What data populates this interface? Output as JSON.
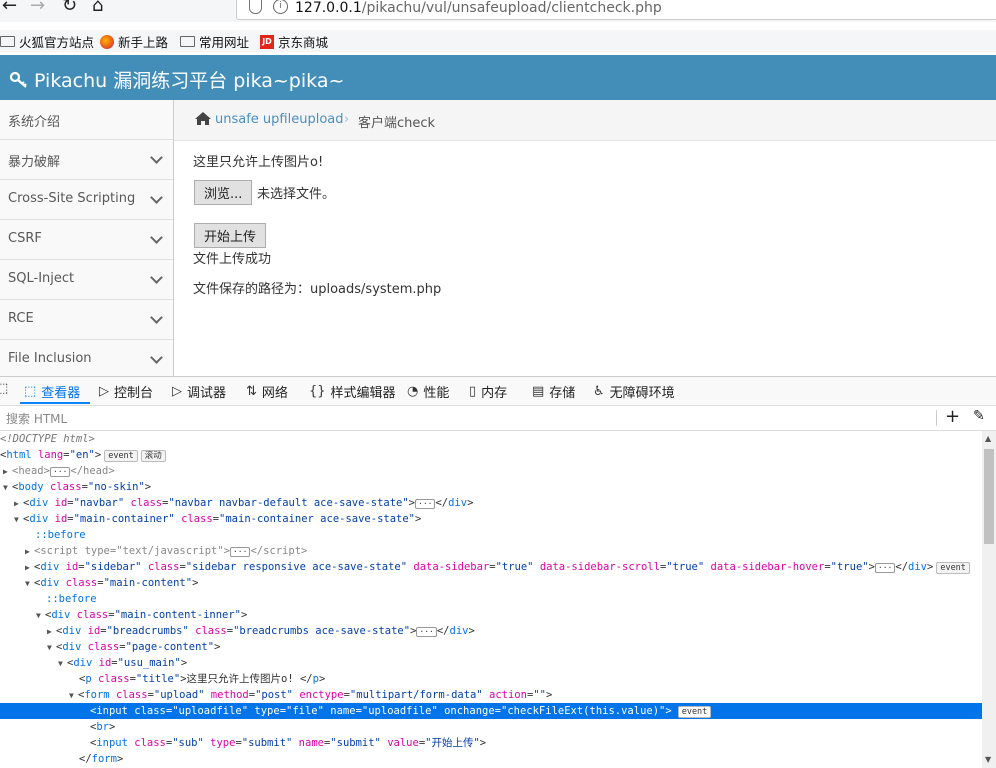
{
  "browser": {
    "url_host": "127.0.0.1",
    "url_path": "/pikachu/vul/unsafeupload/clientcheck.php",
    "bookmarks": [
      "火狐官方站点",
      "新手上路",
      "常用网址",
      "京东商城"
    ]
  },
  "app": {
    "brand": "Pikachu 漏洞练习平台 pika~pika~",
    "sidebar": [
      "系统介绍",
      "暴力破解",
      "Cross-Site Scripting",
      "CSRF",
      "SQL-Inject",
      "RCE",
      "File Inclusion"
    ],
    "breadcrumb": {
      "link": "unsafe upfileupload",
      "sep": "›",
      "current": "客户端check"
    },
    "content": {
      "title": "这里只允许上传图片o!",
      "browse_label": "浏览...",
      "no_file": "未选择文件。",
      "submit_label": "开始上传",
      "success": "文件上传成功",
      "save_path": "文件保存的路径为：uploads/system.php"
    }
  },
  "devtools": {
    "tabs": [
      "查看器",
      "控制台",
      "调试器",
      "网络",
      "样式编辑器",
      "性能",
      "内存",
      "存储",
      "无障碍环境"
    ],
    "active_tab": "查看器",
    "search_placeholder": "搜索 HTML",
    "badges": {
      "event": "event",
      "scroll": "滚动"
    },
    "tree": {
      "doctype": "<!DOCTYPE html>",
      "l1": "html",
      "l1_attr": "lang",
      "l1_val": "\"en\"",
      "l2": "head",
      "l3": "body",
      "l3_attr": "class",
      "l3_val": "\"no-skin\"",
      "l4_id": "\"navbar\"",
      "l4_cls": "\"navbar navbar-default ace-save-state\"",
      "l5_id": "\"main-container\"",
      "l5_cls": "\"main-container ace-save-state\"",
      "before": "::before",
      "l7_type": "\"text/javascript\"",
      "l8_id": "\"sidebar\"",
      "l8_cls": "\"sidebar responsive ace-save-state\"",
      "l8_ds": "\"true\"",
      "l8_dss": "\"true\"",
      "l8_dsh": "\"true\"",
      "l9_cls": "\"main-content\"",
      "l11_cls": "\"main-content-inner\"",
      "l12_id": "\"breadcrumbs\"",
      "l12_cls": "\"breadcrumbs ace-save-state\"",
      "l13_cls": "\"page-content\"",
      "l14_id": "\"usu_main\"",
      "l15_cls": "\"title\"",
      "l15_text": "这里只允许上传图片o! ",
      "l16_cls": "\"upload\"",
      "l16_method": "\"post\"",
      "l16_enc": "\"multipart/form-data\"",
      "l16_action": "\"\"",
      "l17_cls": "\"uploadfile\"",
      "l17_type": "\"file\"",
      "l17_name": "\"uploadfile\"",
      "l17_onchange": "\"checkFileExt(this.value)\"",
      "l19_cls": "\"sub\"",
      "l19_type": "\"submit\"",
      "l19_name": "\"submit\"",
      "l19_value": "\"开始上传\""
    }
  }
}
